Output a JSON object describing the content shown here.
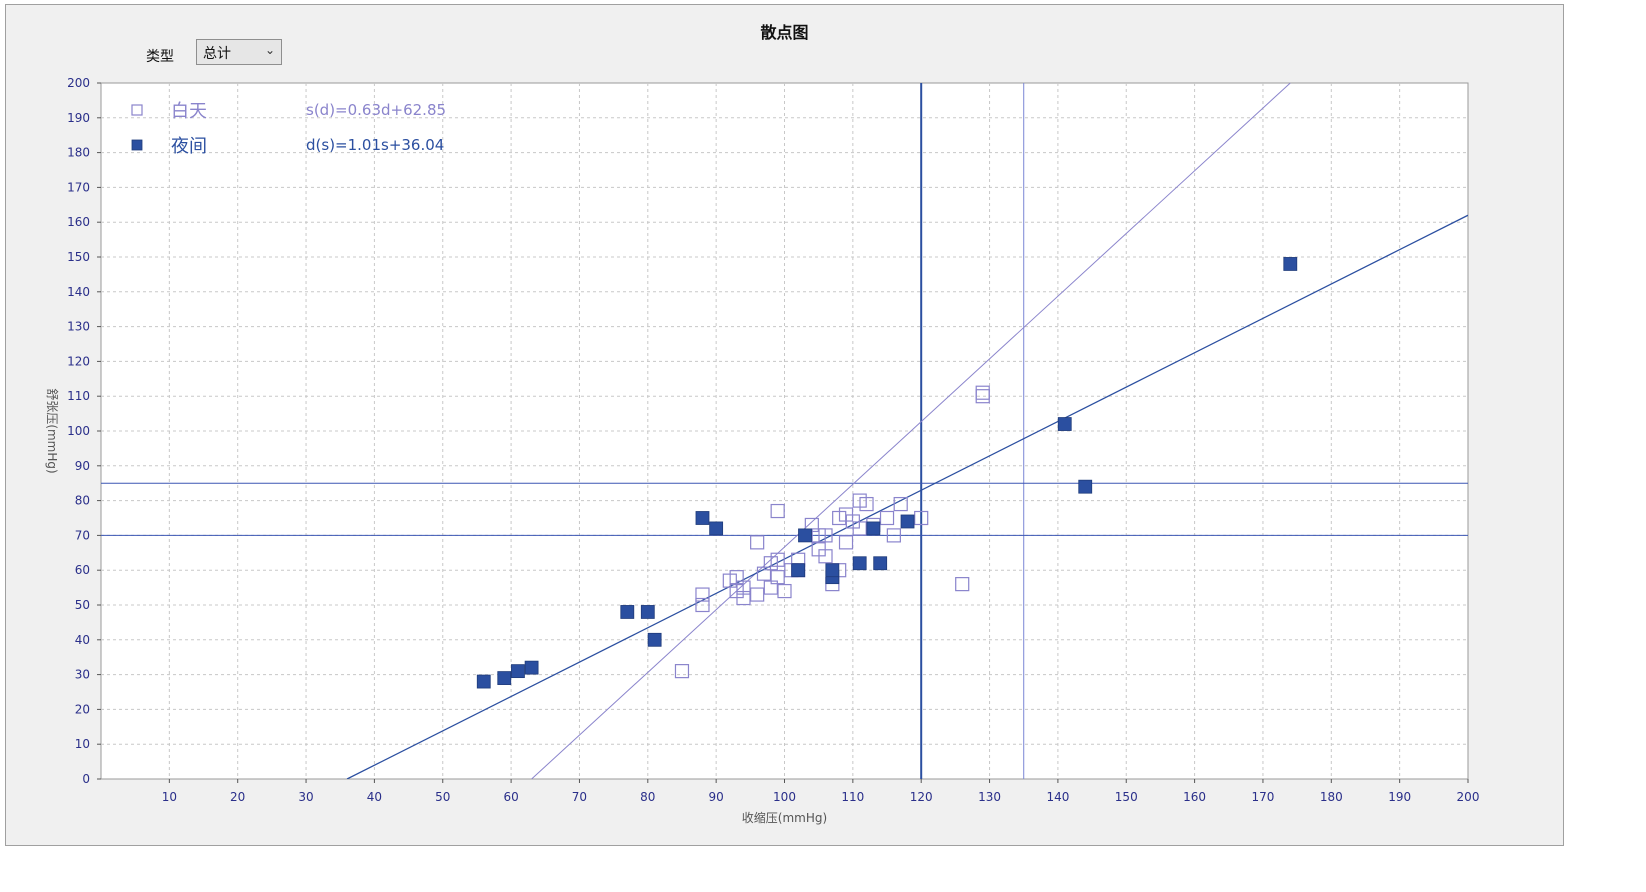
{
  "window": {
    "title": "散点图",
    "type_label": "类型",
    "type_value": "总计"
  },
  "chart_data": {
    "type": "scatter",
    "title": "散点图",
    "xlabel": "收缩压(mmHg)",
    "ylabel": "舒张压(mmHg)",
    "xlim": [
      0,
      200
    ],
    "ylim": [
      0,
      200
    ],
    "xticks": [
      10,
      20,
      30,
      40,
      50,
      60,
      70,
      80,
      90,
      100,
      110,
      120,
      130,
      140,
      150,
      160,
      170,
      180,
      190,
      200
    ],
    "yticks": [
      0,
      10,
      20,
      30,
      40,
      50,
      60,
      70,
      80,
      90,
      100,
      110,
      120,
      130,
      140,
      150,
      160,
      170,
      180,
      190,
      200
    ],
    "grid": true,
    "legend_position": "top-left",
    "colors": {
      "day": "#8a84cc",
      "night": "#2b4fa0",
      "refline": "#3b56b4"
    },
    "series": [
      {
        "name": "白天",
        "marker": "open-square",
        "equation": "s(d)=0.63d+62.85",
        "fit": {
          "x": [
            63,
            174
          ],
          "y": [
            0,
            200
          ]
        },
        "points": [
          [
            85,
            31
          ],
          [
            88,
            50
          ],
          [
            88,
            53
          ],
          [
            92,
            57
          ],
          [
            93,
            54
          ],
          [
            93,
            58
          ],
          [
            94,
            55
          ],
          [
            94,
            52
          ],
          [
            96,
            68
          ],
          [
            96,
            53
          ],
          [
            97,
            59
          ],
          [
            98,
            62
          ],
          [
            98,
            55
          ],
          [
            99,
            77
          ],
          [
            99,
            63
          ],
          [
            99,
            58
          ],
          [
            100,
            54
          ],
          [
            101,
            60
          ],
          [
            102,
            60
          ],
          [
            102,
            63
          ],
          [
            104,
            73
          ],
          [
            105,
            66
          ],
          [
            105,
            70
          ],
          [
            106,
            64
          ],
          [
            106,
            70
          ],
          [
            107,
            56
          ],
          [
            108,
            60
          ],
          [
            108,
            75
          ],
          [
            109,
            68
          ],
          [
            109,
            76
          ],
          [
            110,
            74
          ],
          [
            111,
            80
          ],
          [
            111,
            72
          ],
          [
            112,
            79
          ],
          [
            113,
            73
          ],
          [
            115,
            75
          ],
          [
            116,
            70
          ],
          [
            117,
            79
          ],
          [
            120,
            75
          ],
          [
            126,
            56
          ],
          [
            129,
            110
          ],
          [
            129,
            111
          ]
        ]
      },
      {
        "name": "夜间",
        "marker": "filled-square",
        "equation": "d(s)=1.01s+36.04",
        "fit": {
          "x": [
            36,
            200
          ],
          "y": [
            0,
            162
          ]
        },
        "points": [
          [
            56,
            28
          ],
          [
            59,
            29
          ],
          [
            61,
            31
          ],
          [
            63,
            32
          ],
          [
            77,
            48
          ],
          [
            80,
            48
          ],
          [
            81,
            40
          ],
          [
            88,
            75
          ],
          [
            90,
            72
          ],
          [
            102,
            60
          ],
          [
            103,
            70
          ],
          [
            107,
            58
          ],
          [
            107,
            60
          ],
          [
            111,
            62
          ],
          [
            113,
            72
          ],
          [
            114,
            62
          ],
          [
            118,
            74
          ],
          [
            141,
            102
          ],
          [
            144,
            84
          ],
          [
            174,
            148
          ]
        ]
      }
    ],
    "reference_lines": {
      "vertical": [
        {
          "x": 120,
          "width": "thick"
        },
        {
          "x": 135,
          "width": "thin"
        }
      ],
      "horizontal": [
        {
          "y": 85,
          "width": "thin"
        },
        {
          "y": 70,
          "width": "thin"
        }
      ]
    }
  }
}
